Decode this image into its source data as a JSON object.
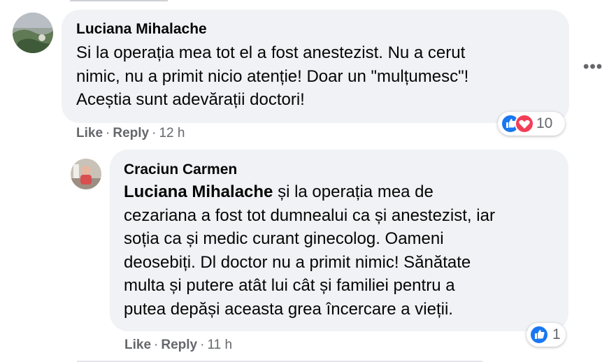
{
  "comments": [
    {
      "author": "Luciana Mihalache",
      "lines": [
        "Si la operația mea tot el a fost anestezist. Nu a cerut",
        "nimic, nu a primit nicio atenție! Doar un \"mulțumesc\"!",
        "Acești a sunt adevărații doctori!"
      ],
      "like_label": "Like",
      "reply_label": "Reply",
      "time": "12 h",
      "reaction_count": "10"
    },
    {
      "author": "Craciun Carmen",
      "mention": "Luciana Mihalache",
      "first_line_rest": " și la operația mea de",
      "lines": [
        "cezariana a fost tot dumnealui ca și anestezist, iar",
        "soția ca și medic curant ginecolog. Oameni",
        "deosebiți. Dl doctor nu a primit nimic! Sănătate",
        "multa și putere atât lui cât și familiei pentru a",
        "putea depăși aceasta grea încercare a vieții."
      ],
      "like_label": "Like",
      "reply_label": "Reply",
      "time": "11 h",
      "reaction_count": "1"
    }
  ],
  "more_options": "•••",
  "colors": {
    "bubble": "#f0f2f5",
    "like_blue": "#1877f2",
    "love_red": "#f33e58",
    "meta_gray": "#65676b"
  },
  "icons": [
    "avatar",
    "like-reaction-icon",
    "love-reaction-icon",
    "more-options-icon"
  ]
}
